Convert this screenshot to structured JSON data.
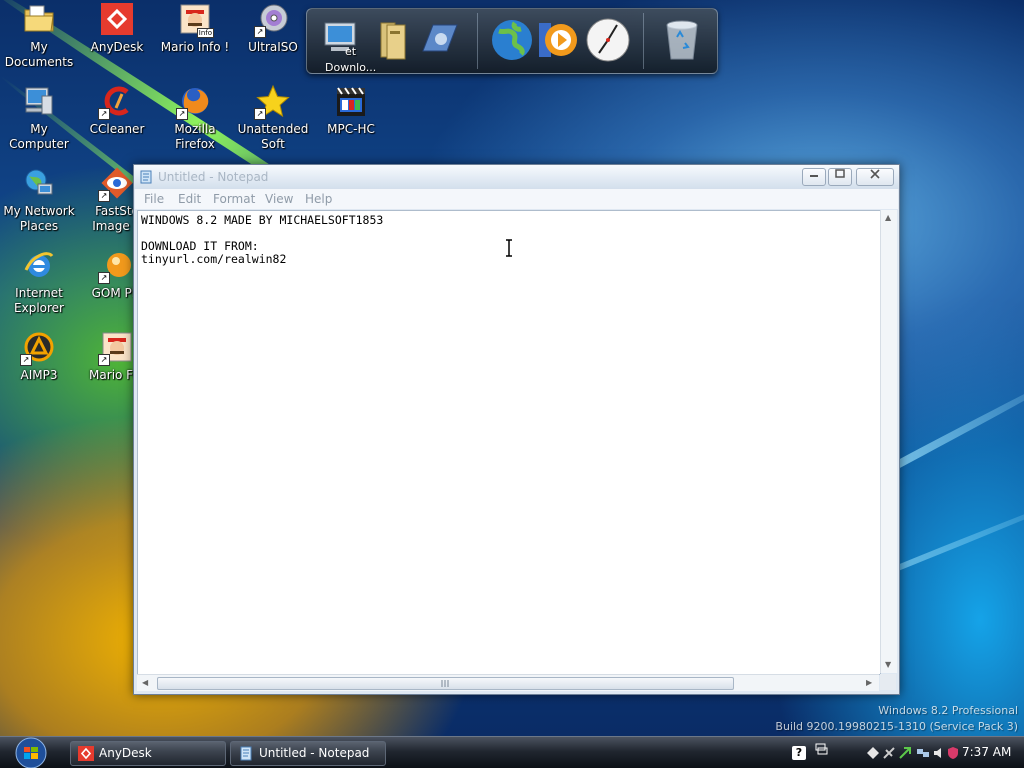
{
  "desktop": {
    "icons": [
      {
        "label": "My Documents"
      },
      {
        "label": "AnyDesk"
      },
      {
        "label": "Mario Info !"
      },
      {
        "label": "UltraISO"
      },
      {
        "label": "My Computer"
      },
      {
        "label": "CCleaner"
      },
      {
        "label": "Mozilla Firefox"
      },
      {
        "label": "Unattended Soft"
      },
      {
        "label": "MPC-HC"
      },
      {
        "label": "My Network Places"
      },
      {
        "label": "FastSto Image V"
      },
      {
        "label": "Internet Explorer"
      },
      {
        "label": "GOM Pla"
      },
      {
        "label": "AIMP3"
      },
      {
        "label": "Mario For"
      }
    ],
    "mario_badge": "Info"
  },
  "dock": {
    "partial_label_top": "et",
    "partial_label_bottom": "Downlo..."
  },
  "notepad": {
    "title": "Untitled - Notepad",
    "menu": [
      "File",
      "Edit",
      "Format",
      "View",
      "Help"
    ],
    "lines": [
      "WINDOWS 8.2 MADE BY MICHAELSOFT1853",
      "",
      "DOWNLOAD IT FROM:",
      "tinyurl.com/realwin82"
    ],
    "controls": {
      "help_glyph": "?"
    }
  },
  "watermark": {
    "line1": "Windows 8.2 Professional",
    "line2": "Build 9200.19980215-1310 (Service Pack 3)"
  },
  "taskbar": {
    "tasks": [
      {
        "label": "AnyDesk",
        "icon": "anydesk-icon"
      },
      {
        "label": "Untitled - Notepad",
        "icon": "notepad-icon"
      }
    ],
    "help_glyph": "?",
    "clock": "7:37 AM"
  },
  "colors": {
    "anydesk": "#e63b2e",
    "accent": "#3b78c4"
  }
}
